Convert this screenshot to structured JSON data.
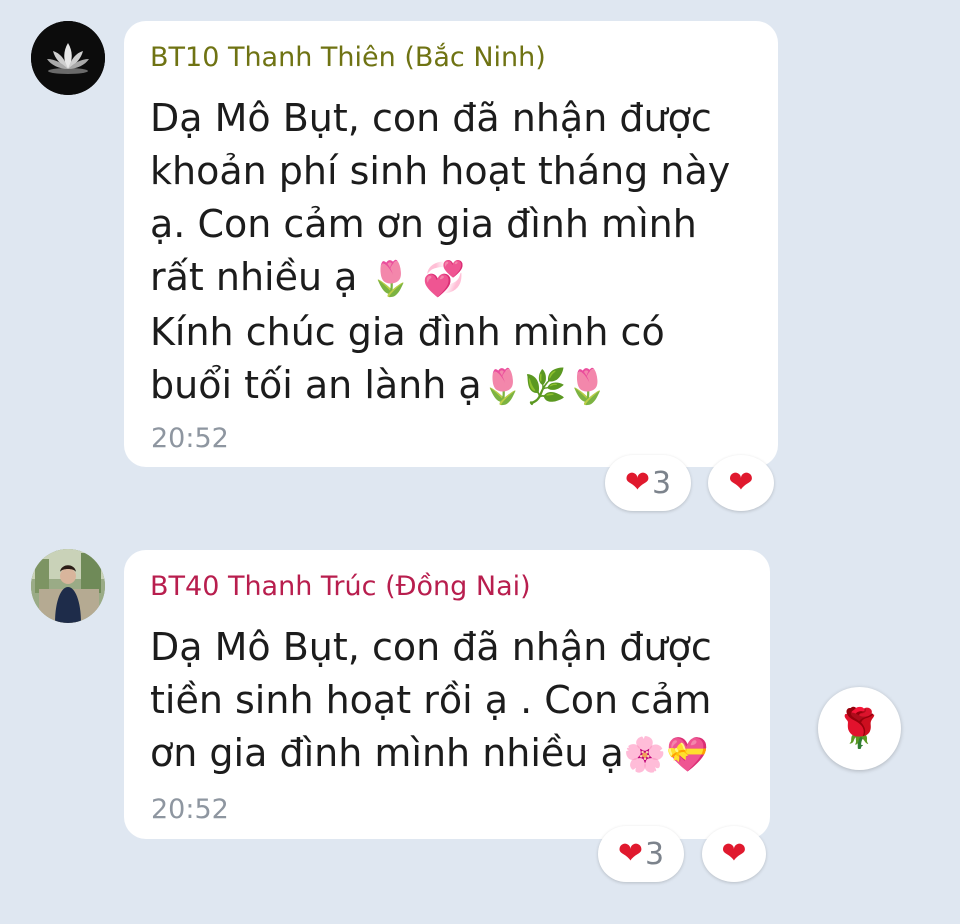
{
  "messages": [
    {
      "sender": "BT10 Thanh Thiên (Bắc Ninh)",
      "sender_color": "#6f7313",
      "avatar": "lotus-avatar",
      "lines": [
        "Dạ Mô Bụt, con đã nhận được",
        "khoản phí sinh hoạt tháng này",
        "ạ. Con cảm ơn gia đình mình",
        "rất nhiều ạ",
        "Kính chúc gia đình mình có",
        "buổi tối an lành ạ"
      ],
      "emoji": {
        "line4": "🌷 💞",
        "line6": "🌷🌿🌷"
      },
      "time": "20:52",
      "reactions": {
        "count_heart": "❤",
        "count": "3",
        "my_heart": "❤"
      }
    },
    {
      "sender": "BT40 Thanh Trúc (Đồng Nai)",
      "sender_color": "#b81e4e",
      "avatar": "person-photo-avatar",
      "lines": [
        "Dạ Mô Bụt, con đã nhận được",
        "tiền sinh hoạt rồi ạ . Con cảm",
        "ơn gia đình mình nhiều ạ"
      ],
      "emoji": {
        "line3": "🌸💝"
      },
      "time": "20:52",
      "reactions": {
        "count_heart": "❤",
        "count": "3",
        "my_heart": "❤"
      }
    }
  ],
  "quick_reaction": {
    "icon": "rose-icon",
    "glyph": "🌹"
  },
  "colors": {
    "background": "#dfe7f1",
    "bubble": "#ffffff",
    "heart": "#e0192e",
    "time": "#8e96a0"
  }
}
